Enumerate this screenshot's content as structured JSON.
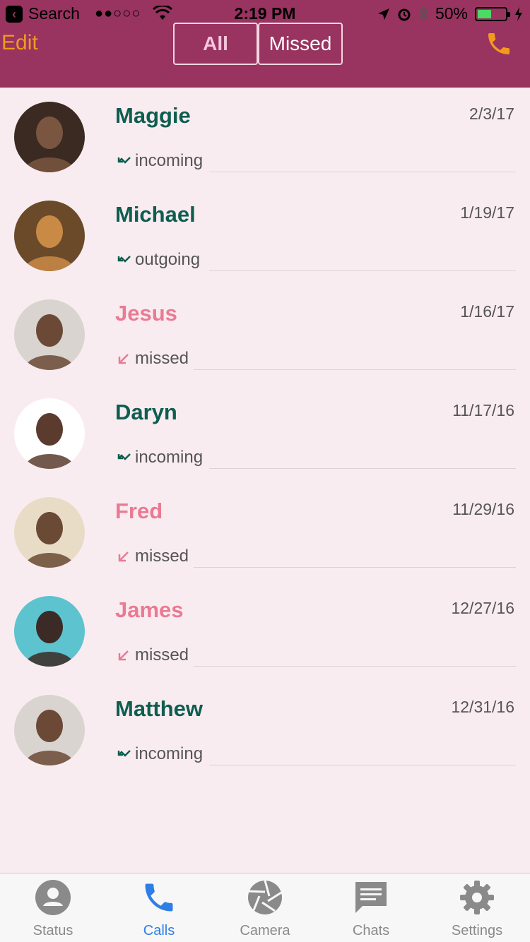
{
  "status_bar": {
    "back_label": "Search",
    "signal": "●●○○○",
    "time": "2:19 PM",
    "battery_percent": "50%",
    "battery_level": 0.5
  },
  "header": {
    "edit_label": "Edit",
    "segments": [
      "All",
      "Missed"
    ],
    "selected_segment": "All",
    "accent_color": "#993360",
    "call_icon": "phone-icon"
  },
  "calls": [
    {
      "name": "Maggie",
      "date": "2/3/17",
      "type": "incoming",
      "missed": false
    },
    {
      "name": "Michael",
      "date": "1/19/17",
      "type": "outgoing",
      "missed": false
    },
    {
      "name": "Jesus",
      "date": "1/16/17",
      "type": "missed",
      "missed": true
    },
    {
      "name": "Daryn",
      "date": "11/17/16",
      "type": "incoming",
      "missed": false
    },
    {
      "name": "Fred",
      "date": "11/29/16",
      "type": "missed",
      "missed": true
    },
    {
      "name": "James",
      "date": "12/27/16",
      "type": "missed",
      "missed": true
    },
    {
      "name": "Matthew",
      "date": "12/31/16",
      "type": "incoming",
      "missed": false
    }
  ],
  "tabbar": {
    "tabs": [
      {
        "label": "Status",
        "icon": "person-icon"
      },
      {
        "label": "Calls",
        "icon": "phone-icon"
      },
      {
        "label": "Camera",
        "icon": "aperture-icon"
      },
      {
        "label": "Chats",
        "icon": "chat-icon"
      },
      {
        "label": "Settings",
        "icon": "gear-icon"
      }
    ],
    "active": "Calls"
  }
}
